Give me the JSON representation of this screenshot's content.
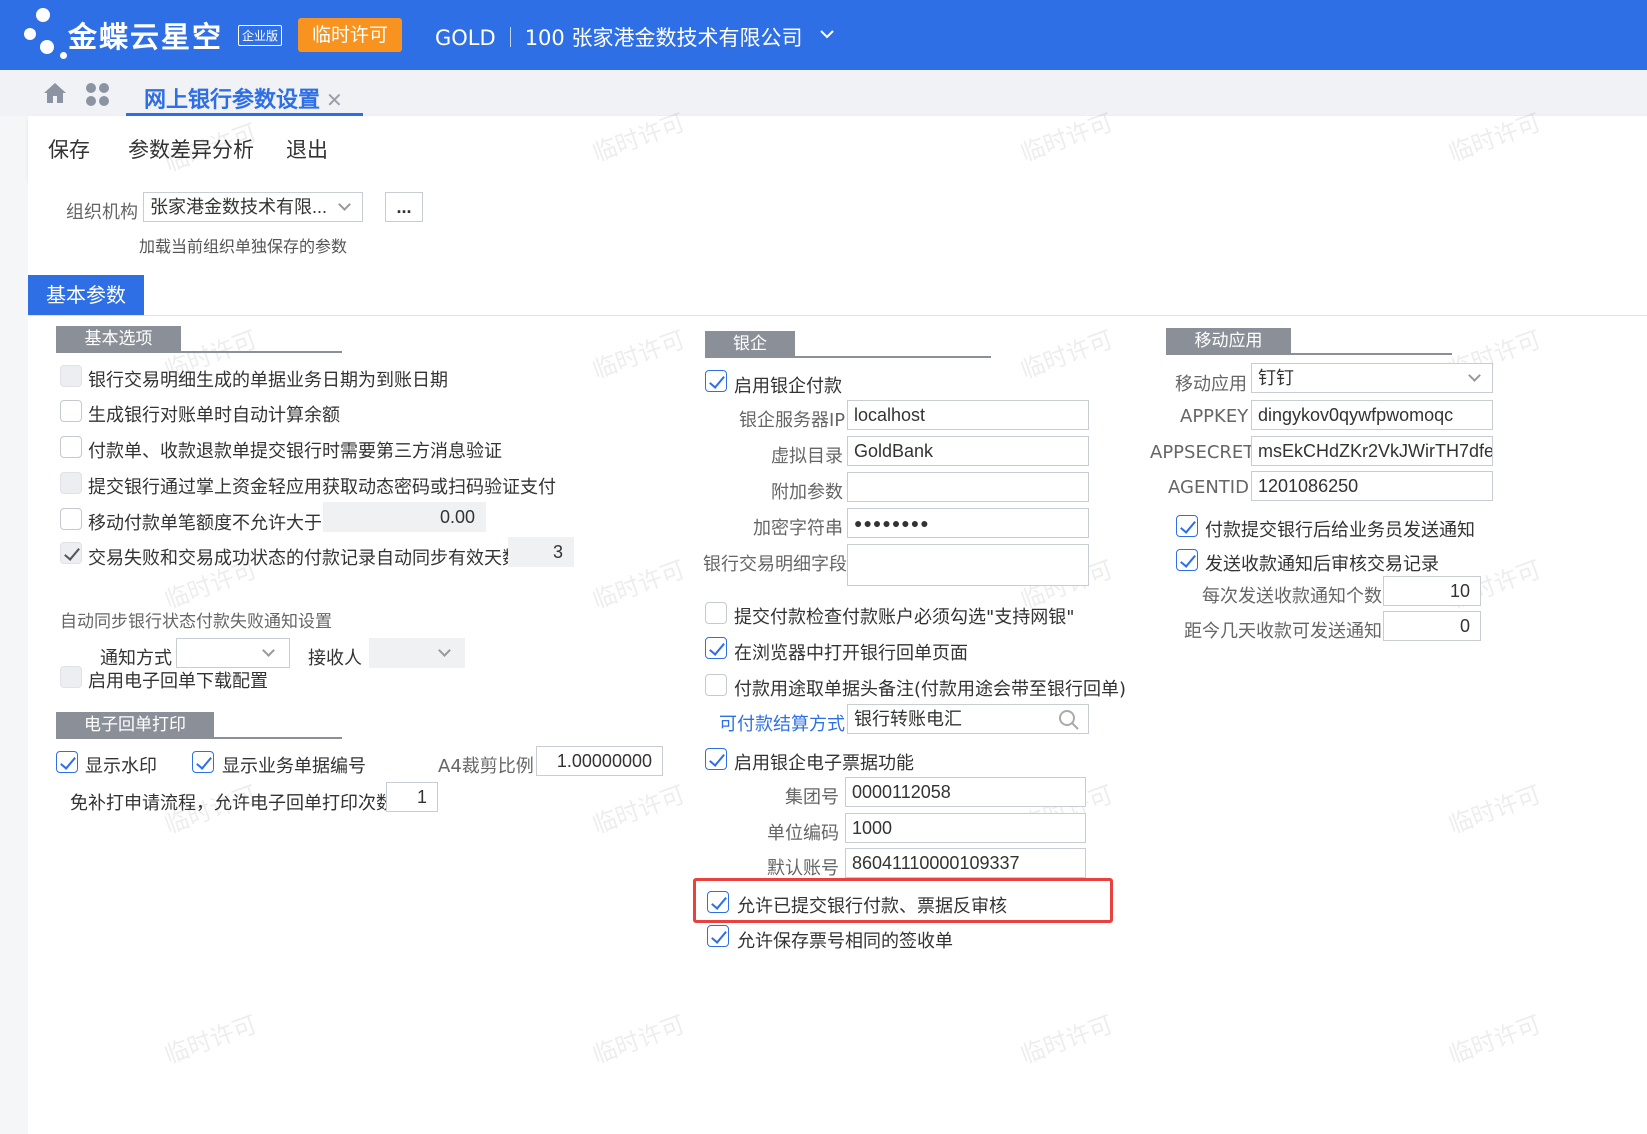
{
  "app": {
    "brand": "金蝶云星空",
    "edition": "企业版",
    "trial_badge": "临时许可",
    "user": "GOLD",
    "org_name": "100 张家港金数技术有限公司"
  },
  "tabs": {
    "active_label": "网上银行参数设置"
  },
  "toolbar": {
    "save": "保存",
    "diff": "参数差异分析",
    "exit": "退出"
  },
  "org_select": {
    "label": "组织机构",
    "value": "张家港金数技术有限...",
    "more": "...",
    "hint": "加载当前组织单独保存的参数"
  },
  "param_tab": "基本参数",
  "watermark": "临时许可",
  "basic": {
    "title": "基本选项",
    "opt1": "银行交易明细生成的单据业务日期为到账日期",
    "opt2": "生成银行对账单时自动计算余额",
    "opt3": "付款单、收款退款单提交银行时需要第三方消息验证",
    "opt4": "提交银行通过掌上资金轻应用获取动态密码或扫码验证支付",
    "opt5": "移动付款单笔额度不允许大于",
    "opt5_value": "0.00",
    "opt6": "交易失败和交易成功状态的付款记录自动同步有效天数",
    "opt6_value": "3",
    "notify_title": "自动同步银行状态付款失败通知设置",
    "notify_method_label": "通知方式",
    "notify_method_value": "",
    "receiver_label": "接收人",
    "receiver_value": "",
    "e_receipt_cfg": "启用电子回单下载配置"
  },
  "eprint": {
    "title": "电子回单打印",
    "watermark_label": "显示水印",
    "show_billno_label": "显示业务单据编号",
    "a4_label": "A4裁剪比例",
    "a4_value": "1.00000000",
    "reprint_label": "免补打申请流程，允许电子回单打印次数",
    "reprint_value": "1"
  },
  "bank": {
    "title": "银企",
    "enable_pay": "启用银企付款",
    "server_ip_label": "银企服务器IP",
    "server_ip_value": "localhost",
    "vdir_label": "虚拟目录",
    "vdir_value": "GoldBank",
    "extra_label": "附加参数",
    "extra_value": "",
    "encrypt_label": "加密字符串",
    "encrypt_value": "●●●●●●●●",
    "detail_field_label": "银行交易明细字段",
    "detail_field_value": "",
    "check_netbank": "提交付款检查付款账户必须勾选\"支持网银\"",
    "open_browser": "在浏览器中打开银行回单页面",
    "use_remark": "付款用途取单据头备注(付款用途会带至银行回单)",
    "settle_label": "可付款结算方式",
    "settle_value": "银行转账电汇",
    "enable_ebill": "启用银企电子票据功能",
    "group_label": "集团号",
    "group_value": "0000112058",
    "unit_label": "单位编码",
    "unit_value": "1000",
    "account_label": "默认账号",
    "account_value": "86041110000109337",
    "allow_unaudit": "允许已提交银行付款、票据反审核",
    "allow_same_no": "允许保存票号相同的签收单"
  },
  "mobile": {
    "title": "移动应用",
    "app_label": "移动应用",
    "app_value": "钉钉",
    "appkey_label": "APPKEY",
    "appkey_value": "dingykov0qywfpwomoqc",
    "appsecret_label": "APPSECRET",
    "appsecret_value": "msEkCHdZKr2VkJWirTH7dfe",
    "agentid_label": "AGENTID",
    "agentid_value": "1201086250",
    "notify_sales": "付款提交银行后给业务员发送通知",
    "audit_record": "发送收款通知后审核交易记录",
    "per_send_label": "每次发送收款通知个数",
    "per_send_value": "10",
    "days_label": "距今几天收款可发送通知",
    "days_value": "0"
  }
}
